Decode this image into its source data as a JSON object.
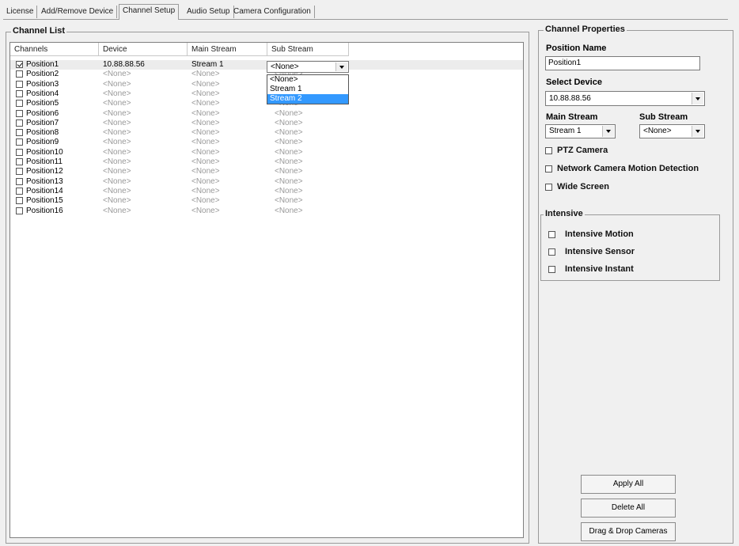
{
  "tabs": [
    "License",
    "Add/Remove Device",
    "Channel Setup",
    "Audio Setup",
    "Camera Configuration"
  ],
  "active_tab": "Channel Setup",
  "channel_list": {
    "title": "Channel List",
    "columns": [
      "Channels",
      "Device",
      "Main Stream",
      "Sub Stream"
    ],
    "rows": [
      {
        "channel": "Position1",
        "device": "10.88.88.56",
        "main": "Stream 1",
        "sub": "<None>",
        "checked": true
      },
      {
        "channel": "Position2",
        "device": "<None>",
        "main": "<None>",
        "sub": "<None>",
        "checked": false
      },
      {
        "channel": "Position3",
        "device": "<None>",
        "main": "<None>",
        "sub": "<None>",
        "checked": false
      },
      {
        "channel": "Position4",
        "device": "<None>",
        "main": "<None>",
        "sub": "<None>",
        "checked": false
      },
      {
        "channel": "Position5",
        "device": "<None>",
        "main": "<None>",
        "sub": "<None>",
        "checked": false
      },
      {
        "channel": "Position6",
        "device": "<None>",
        "main": "<None>",
        "sub": "<None>",
        "checked": false
      },
      {
        "channel": "Position7",
        "device": "<None>",
        "main": "<None>",
        "sub": "<None>",
        "checked": false
      },
      {
        "channel": "Position8",
        "device": "<None>",
        "main": "<None>",
        "sub": "<None>",
        "checked": false
      },
      {
        "channel": "Position9",
        "device": "<None>",
        "main": "<None>",
        "sub": "<None>",
        "checked": false
      },
      {
        "channel": "Position10",
        "device": "<None>",
        "main": "<None>",
        "sub": "<None>",
        "checked": false
      },
      {
        "channel": "Position11",
        "device": "<None>",
        "main": "<None>",
        "sub": "<None>",
        "checked": false
      },
      {
        "channel": "Position12",
        "device": "<None>",
        "main": "<None>",
        "sub": "<None>",
        "checked": false
      },
      {
        "channel": "Position13",
        "device": "<None>",
        "main": "<None>",
        "sub": "<None>",
        "checked": false
      },
      {
        "channel": "Position14",
        "device": "<None>",
        "main": "<None>",
        "sub": "<None>",
        "checked": false
      },
      {
        "channel": "Position15",
        "device": "<None>",
        "main": "<None>",
        "sub": "<None>",
        "checked": false
      },
      {
        "channel": "Position16",
        "device": "<None>",
        "main": "<None>",
        "sub": "<None>",
        "checked": false
      }
    ],
    "sub_stream_dropdown": {
      "value": "<None>",
      "options": [
        "<None>",
        "Stream 1",
        "Stream 2"
      ],
      "highlighted": "Stream 2"
    }
  },
  "properties": {
    "title": "Channel Properties",
    "position_name_label": "Position Name",
    "position_name_value": "Position1",
    "select_device_label": "Select Device",
    "select_device_value": "10.88.88.56",
    "main_stream_label": "Main Stream",
    "main_stream_value": "Stream 1",
    "sub_stream_label": "Sub Stream",
    "sub_stream_value": "<None>",
    "ptz_label": "PTZ Camera",
    "motion_label": "Network Camera Motion Detection",
    "wide_label": "Wide Screen",
    "intensive": {
      "title": "Intensive",
      "motion": "Intensive Motion",
      "sensor": "Intensive Sensor",
      "instant": "Intensive Instant"
    },
    "buttons": {
      "apply_all": "Apply All",
      "delete_all": "Delete All",
      "drag_drop": "Drag & Drop Cameras"
    }
  },
  "colors": {
    "highlight": "#3399ff",
    "panel_bg": "#f0f0f0",
    "muted_text": "#999999"
  }
}
